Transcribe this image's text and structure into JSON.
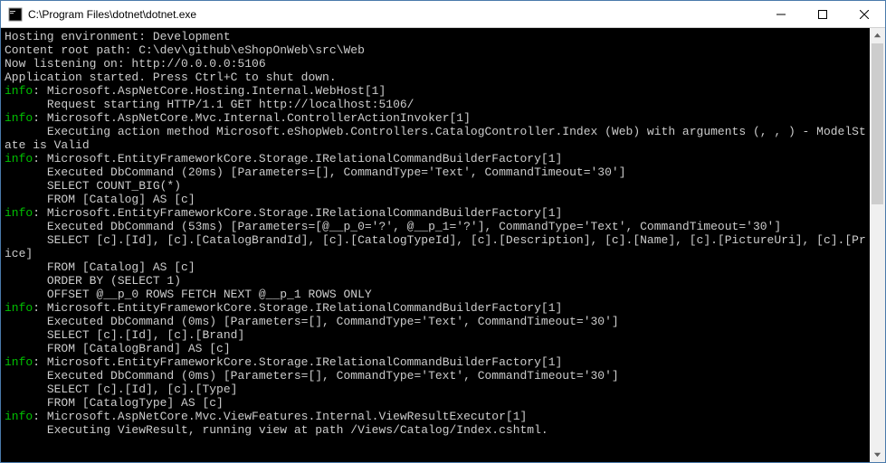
{
  "window": {
    "title": "C:\\Program Files\\dotnet\\dotnet.exe"
  },
  "colors": {
    "info": "#00c000",
    "text": "#cccccc",
    "bg": "#000000"
  },
  "lines": [
    {
      "prefix": "",
      "text": "Hosting environment: Development"
    },
    {
      "prefix": "",
      "text": "Content root path: C:\\dev\\github\\eShopOnWeb\\src\\Web"
    },
    {
      "prefix": "",
      "text": "Now listening on: http://0.0.0.0:5106"
    },
    {
      "prefix": "",
      "text": "Application started. Press Ctrl+C to shut down."
    },
    {
      "prefix": "info",
      "text": ": Microsoft.AspNetCore.Hosting.Internal.WebHost[1]"
    },
    {
      "prefix": "",
      "text": "      Request starting HTTP/1.1 GET http://localhost:5106/"
    },
    {
      "prefix": "info",
      "text": ": Microsoft.AspNetCore.Mvc.Internal.ControllerActionInvoker[1]"
    },
    {
      "prefix": "",
      "text": "      Executing action method Microsoft.eShopWeb.Controllers.CatalogController.Index (Web) with arguments (, , ) - ModelState is Valid"
    },
    {
      "prefix": "info",
      "text": ": Microsoft.EntityFrameworkCore.Storage.IRelationalCommandBuilderFactory[1]"
    },
    {
      "prefix": "",
      "text": "      Executed DbCommand (20ms) [Parameters=[], CommandType='Text', CommandTimeout='30']"
    },
    {
      "prefix": "",
      "text": "      SELECT COUNT_BIG(*)"
    },
    {
      "prefix": "",
      "text": "      FROM [Catalog] AS [c]"
    },
    {
      "prefix": "info",
      "text": ": Microsoft.EntityFrameworkCore.Storage.IRelationalCommandBuilderFactory[1]"
    },
    {
      "prefix": "",
      "text": "      Executed DbCommand (53ms) [Parameters=[@__p_0='?', @__p_1='?'], CommandType='Text', CommandTimeout='30']"
    },
    {
      "prefix": "",
      "text": "      SELECT [c].[Id], [c].[CatalogBrandId], [c].[CatalogTypeId], [c].[Description], [c].[Name], [c].[PictureUri], [c].[Price]"
    },
    {
      "prefix": "",
      "text": "      FROM [Catalog] AS [c]"
    },
    {
      "prefix": "",
      "text": "      ORDER BY (SELECT 1)"
    },
    {
      "prefix": "",
      "text": "      OFFSET @__p_0 ROWS FETCH NEXT @__p_1 ROWS ONLY"
    },
    {
      "prefix": "info",
      "text": ": Microsoft.EntityFrameworkCore.Storage.IRelationalCommandBuilderFactory[1]"
    },
    {
      "prefix": "",
      "text": "      Executed DbCommand (0ms) [Parameters=[], CommandType='Text', CommandTimeout='30']"
    },
    {
      "prefix": "",
      "text": "      SELECT [c].[Id], [c].[Brand]"
    },
    {
      "prefix": "",
      "text": "      FROM [CatalogBrand] AS [c]"
    },
    {
      "prefix": "info",
      "text": ": Microsoft.EntityFrameworkCore.Storage.IRelationalCommandBuilderFactory[1]"
    },
    {
      "prefix": "",
      "text": "      Executed DbCommand (0ms) [Parameters=[], CommandType='Text', CommandTimeout='30']"
    },
    {
      "prefix": "",
      "text": "      SELECT [c].[Id], [c].[Type]"
    },
    {
      "prefix": "",
      "text": "      FROM [CatalogType] AS [c]"
    },
    {
      "prefix": "info",
      "text": ": Microsoft.AspNetCore.Mvc.ViewFeatures.Internal.ViewResultExecutor[1]"
    },
    {
      "prefix": "",
      "text": "      Executing ViewResult, running view at path /Views/Catalog/Index.cshtml."
    }
  ]
}
